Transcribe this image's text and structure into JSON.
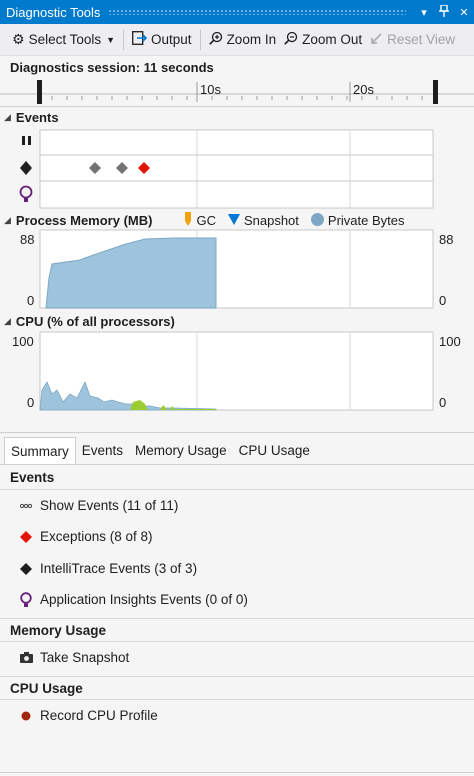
{
  "window": {
    "title": "Diagnostic Tools",
    "pin_icon": "pin-icon",
    "close_icon": "close-icon"
  },
  "toolbar": {
    "select_tools": "Select Tools",
    "output": "Output",
    "zoom_in": "Zoom In",
    "zoom_out": "Zoom Out",
    "reset_view": "Reset View"
  },
  "session": {
    "label": "Diagnostics session: 11 seconds",
    "ruler_ticks": [
      "10s",
      "20s"
    ]
  },
  "events_panel": {
    "title": "Events",
    "rows": [
      "pause-icon",
      "intellitrace-diamond-icon",
      "app-insights-icon"
    ],
    "colors": {
      "exception": "#e51400",
      "intellitrace": "#737373"
    }
  },
  "memory_panel": {
    "title": "Process Memory (MB)",
    "legend": [
      "GC",
      "Snapshot",
      "Private Bytes"
    ],
    "legend_colors": [
      "#f0a30a",
      "#0078d7",
      "#7da7c4"
    ],
    "y_max": "88",
    "y_min": "0"
  },
  "cpu_panel": {
    "title": "CPU (% of all processors)",
    "y_max": "100",
    "y_min": "0",
    "series_colors": [
      "#8fb9d4",
      "#9acd32"
    ]
  },
  "tabs": [
    "Summary",
    "Events",
    "Memory Usage",
    "CPU Usage"
  ],
  "summary": {
    "events_head": "Events",
    "events_items": [
      {
        "label": "Show Events (11 of 11)",
        "icon": "show-events-icon"
      },
      {
        "label": "Exceptions (8 of 8)",
        "icon": "exception-diamond-icon"
      },
      {
        "label": "IntelliTrace Events (3 of 3)",
        "icon": "intellitrace-diamond-icon"
      },
      {
        "label": "Application Insights Events (0 of 0)",
        "icon": "app-insights-icon"
      }
    ],
    "memory_head": "Memory Usage",
    "memory_items": [
      {
        "label": "Take Snapshot",
        "icon": "camera-icon"
      }
    ],
    "cpu_head": "CPU Usage",
    "cpu_items": [
      {
        "label": "Record CPU Profile",
        "icon": "record-icon"
      }
    ]
  }
}
